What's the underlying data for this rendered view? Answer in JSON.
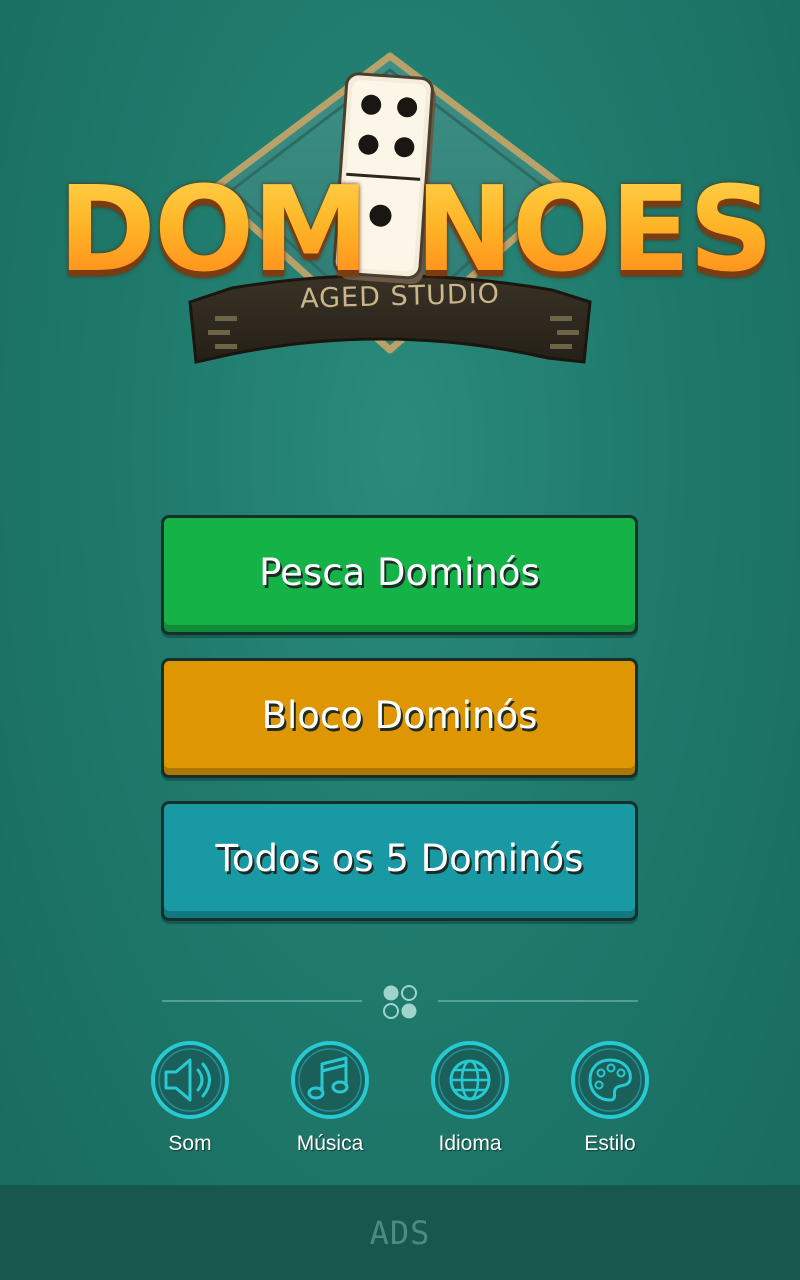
{
  "logo": {
    "title_left": "DOM",
    "title_right": "NOES",
    "subtitle": "AGED STUDIO"
  },
  "menu": {
    "buttons": [
      {
        "label": "Pesca Dominós",
        "color": "#15b347"
      },
      {
        "label": "Bloco Dominós",
        "color": "#de9703"
      },
      {
        "label": "Todos os 5 Dominós",
        "color": "#1999a3"
      }
    ]
  },
  "settings": {
    "items": [
      {
        "label": "Som",
        "icon": "speaker-icon"
      },
      {
        "label": "Música",
        "icon": "music-note-icon"
      },
      {
        "label": "Idioma",
        "icon": "globe-icon"
      },
      {
        "label": "Estilo",
        "icon": "palette-icon"
      }
    ]
  },
  "ads": {
    "label": "ADS"
  },
  "colors": {
    "background": "#1f7a6c",
    "icon_accent": "#27c9d2",
    "ads_bar": "#17574d"
  }
}
